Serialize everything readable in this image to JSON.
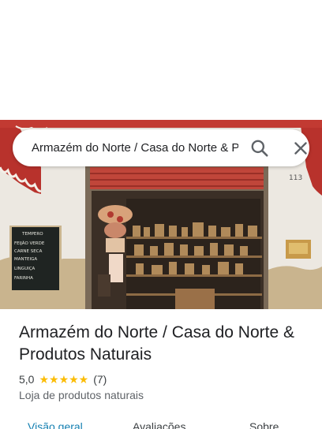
{
  "search": {
    "query": "Armazém do Norte / Casa do Norte & Produtos Naturais"
  },
  "place": {
    "title": "Armazém do Norte / Casa do Norte & Produtos Naturais",
    "rating": "5,0",
    "stars": "★★★★★",
    "review_count": "(7)",
    "category": "Loja de produtos naturais"
  },
  "photo": {
    "house_number": "113",
    "chalkboard_lines": [
      "TEMPERO",
      "FEIJÃO VERDE",
      "CARNE SECA",
      "MANTEIGA",
      "LINGUIÇA",
      "FARINHA"
    ]
  },
  "tabs": [
    {
      "label": "Visão geral",
      "active": true
    },
    {
      "label": "Avaliações",
      "active": false
    },
    {
      "label": "Sobre",
      "active": false
    }
  ],
  "colors": {
    "accent": "#137fb1",
    "star": "#fbbc04",
    "awning_red": "#c8322b"
  },
  "icons": {
    "search": "search-icon",
    "close": "close-icon"
  }
}
